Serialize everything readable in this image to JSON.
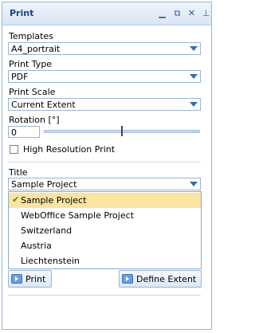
{
  "window": {
    "title": "Print"
  },
  "toolbar_icons": [
    "minimize-icon",
    "restore-icon",
    "close-icon",
    "pin-icon"
  ],
  "templates": {
    "label": "Templates",
    "value": "A4_portrait"
  },
  "print_type": {
    "label": "Print Type",
    "value": "PDF"
  },
  "print_scale": {
    "label": "Print Scale",
    "value": "Current Extent"
  },
  "rotation": {
    "label": "Rotation [°]",
    "value": "0"
  },
  "high_res": {
    "label": "High Resolution Print",
    "checked": false
  },
  "title_field": {
    "label": "Title",
    "value": "Sample Project",
    "options": [
      "Sample Project",
      "WebOffice Sample Project",
      "Switzerland",
      "Austria",
      "Liechtenstein"
    ],
    "selected_index": 0
  },
  "buttons": {
    "print": "Print",
    "define_extent": "Define Extent"
  }
}
